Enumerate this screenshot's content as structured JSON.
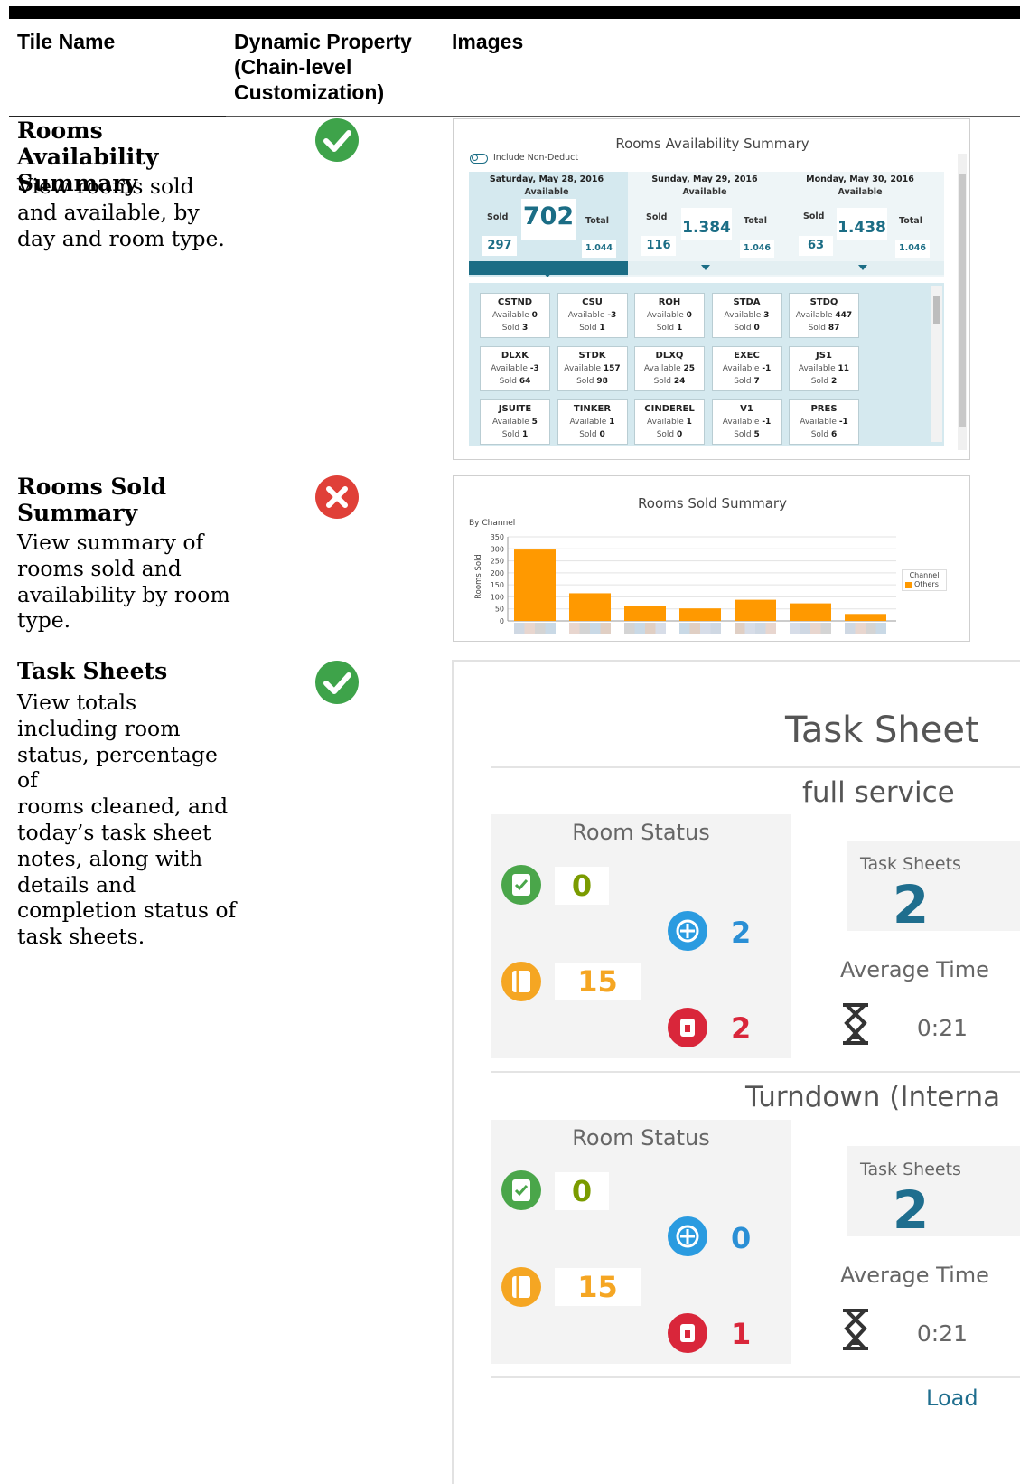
{
  "table": {
    "headers": {
      "col1": "Tile Name",
      "col2_line1": "Dynamic Property",
      "col2_line2": "(Chain-level",
      "col2_line3": "Customization)",
      "col3": "Images"
    }
  },
  "rows": [
    {
      "name_line1": "Rooms Availability",
      "name_line2": "Summary",
      "desc": [
        "View rooms sold",
        "and available, by",
        "day and room type."
      ],
      "dynamic": "yes"
    },
    {
      "name_line1": "Rooms Sold",
      "name_line2": "Summary",
      "desc": [
        "View summary of",
        "rooms sold and",
        "availability by room",
        "type."
      ],
      "dynamic": "no"
    },
    {
      "name_line1": "Task Sheets",
      "name_line2": "",
      "desc": [
        "View totals",
        "including room",
        "status, percentage of",
        "rooms cleaned, and",
        "today’s task sheet",
        "notes, along with",
        "details and",
        "completion status of",
        "task sheets."
      ],
      "dynamic": "yes"
    }
  ],
  "colors": {
    "yes": "#3ea34a",
    "no": "#e04038",
    "orange": "#ff9900",
    "teal": "#1b6d85"
  },
  "avail": {
    "title": "Rooms Availability Summary",
    "toggle_label": "Include Non-Deduct",
    "days": [
      {
        "date": "Saturday, May 28, 2016",
        "available_label": "Available",
        "sold_label": "Sold",
        "total_label": "Total",
        "available": "702",
        "sold": "297",
        "total": "1.044"
      },
      {
        "date": "Sunday, May 29, 2016",
        "available_label": "Available",
        "sold_label": "Sold",
        "total_label": "Total",
        "available": "1.384",
        "sold": "116",
        "total": "1.046"
      },
      {
        "date": "Monday, May 30, 2016",
        "available_label": "Available",
        "sold_label": "Sold",
        "total_label": "Total",
        "available": "1.438",
        "sold": "63",
        "total": "1.046"
      }
    ],
    "room_types": [
      {
        "code": "CSTND",
        "a_label": "Available",
        "available": "0",
        "s_label": "Sold",
        "sold": "3"
      },
      {
        "code": "CSU",
        "a_label": "Available",
        "available": "-3",
        "s_label": "Sold",
        "sold": "1"
      },
      {
        "code": "ROH",
        "a_label": "Available",
        "available": "0",
        "s_label": "Sold",
        "sold": "1"
      },
      {
        "code": "STDA",
        "a_label": "Available",
        "available": "3",
        "s_label": "Sold",
        "sold": "0"
      },
      {
        "code": "STDQ",
        "a_label": "Available",
        "available": "447",
        "s_label": "Sold",
        "sold": "87"
      },
      {
        "code": "DLXK",
        "a_label": "Available",
        "available": "-3",
        "s_label": "Sold",
        "sold": "64"
      },
      {
        "code": "STDK",
        "a_label": "Available",
        "available": "157",
        "s_label": "Sold",
        "sold": "98"
      },
      {
        "code": "DLXQ",
        "a_label": "Available",
        "available": "25",
        "s_label": "Sold",
        "sold": "24"
      },
      {
        "code": "EXEC",
        "a_label": "Available",
        "available": "-1",
        "s_label": "Sold",
        "sold": "7"
      },
      {
        "code": "JS1",
        "a_label": "Available",
        "available": "11",
        "s_label": "Sold",
        "sold": "2"
      },
      {
        "code": "JSUITE",
        "a_label": "Available",
        "available": "5",
        "s_label": "Sold",
        "sold": "1"
      },
      {
        "code": "TINKER",
        "a_label": "Available",
        "available": "1",
        "s_label": "Sold",
        "sold": "0"
      },
      {
        "code": "CINDEREL",
        "a_label": "Available",
        "available": "1",
        "s_label": "Sold",
        "sold": "0"
      },
      {
        "code": "V1",
        "a_label": "Available",
        "available": "-1",
        "s_label": "Sold",
        "sold": "5"
      },
      {
        "code": "PRES",
        "a_label": "Available",
        "available": "-1",
        "s_label": "Sold",
        "sold": "6"
      }
    ]
  },
  "sold": {
    "title": "Rooms Sold Summary",
    "subtitle": "By Channel",
    "legend_title": "Channel",
    "legend_item": "Others"
  },
  "chart_data": {
    "type": "bar",
    "title": "Rooms Sold Summary",
    "subtitle": "By Channel",
    "xlabel": "",
    "ylabel": "Rooms Sold",
    "ylim": [
      0,
      350
    ],
    "yticks": [
      0,
      50,
      100,
      150,
      200,
      250,
      300,
      350
    ],
    "grid": true,
    "legend_position": "right",
    "series": [
      {
        "name": "Others",
        "color": "#ff9900",
        "values": [
          297,
          115,
          62,
          52,
          88,
          73,
          29
        ]
      }
    ]
  },
  "task": {
    "title": "Task Sheet",
    "sections": [
      {
        "name": "full service",
        "room_status_label": "Room Status",
        "clean": "0",
        "inspected": "2",
        "dirty": "15",
        "out": "2",
        "task_sheets_label": "Task Sheets",
        "task_sheets": "2",
        "avg_label": "Average Time",
        "avg": "0:21"
      },
      {
        "name": "Turndown (Interna",
        "room_status_label": "Room Status",
        "clean": "0",
        "inspected": "0",
        "dirty": "15",
        "out": "1",
        "task_sheets_label": "Task Sheets",
        "task_sheets": "2",
        "avg_label": "Average Time",
        "avg": "0:21"
      }
    ],
    "footer": "Load"
  }
}
